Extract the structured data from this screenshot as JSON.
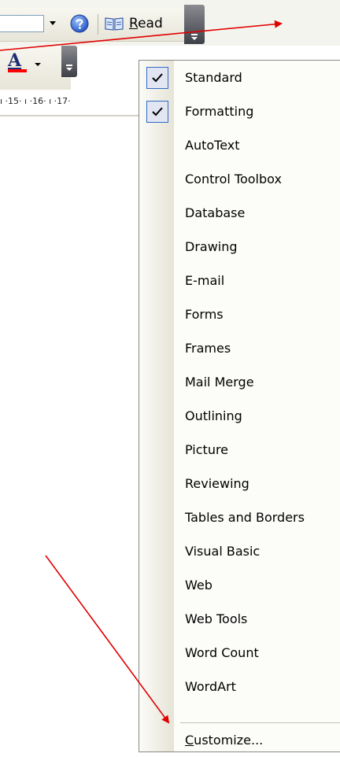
{
  "toolbar": {
    "read_label": "Read",
    "read_accel": "R"
  },
  "ruler": {
    "text": "ı ·15· ı ·16· ı ·17·"
  },
  "menu": {
    "items": [
      {
        "label": "Standard",
        "checked": true
      },
      {
        "label": "Formatting",
        "checked": true
      },
      {
        "label": "AutoText",
        "checked": false
      },
      {
        "label": "Control Toolbox",
        "checked": false
      },
      {
        "label": "Database",
        "checked": false
      },
      {
        "label": "Drawing",
        "checked": false
      },
      {
        "label": "E-mail",
        "checked": false
      },
      {
        "label": "Forms",
        "checked": false
      },
      {
        "label": "Frames",
        "checked": false
      },
      {
        "label": "Mail Merge",
        "checked": false
      },
      {
        "label": "Outlining",
        "checked": false
      },
      {
        "label": "Picture",
        "checked": false
      },
      {
        "label": "Reviewing",
        "checked": false
      },
      {
        "label": "Tables and Borders",
        "checked": false
      },
      {
        "label": "Visual Basic",
        "checked": false
      },
      {
        "label": "Web",
        "checked": false
      },
      {
        "label": "Web Tools",
        "checked": false
      },
      {
        "label": "Word Count",
        "checked": false
      },
      {
        "label": "WordArt",
        "checked": false
      }
    ],
    "customize": {
      "accel": "C",
      "rest": "ustomize..."
    }
  },
  "colors": {
    "accent": "#316ac5",
    "arrow": "#e00000",
    "font_color_bar": "#ff0000"
  }
}
